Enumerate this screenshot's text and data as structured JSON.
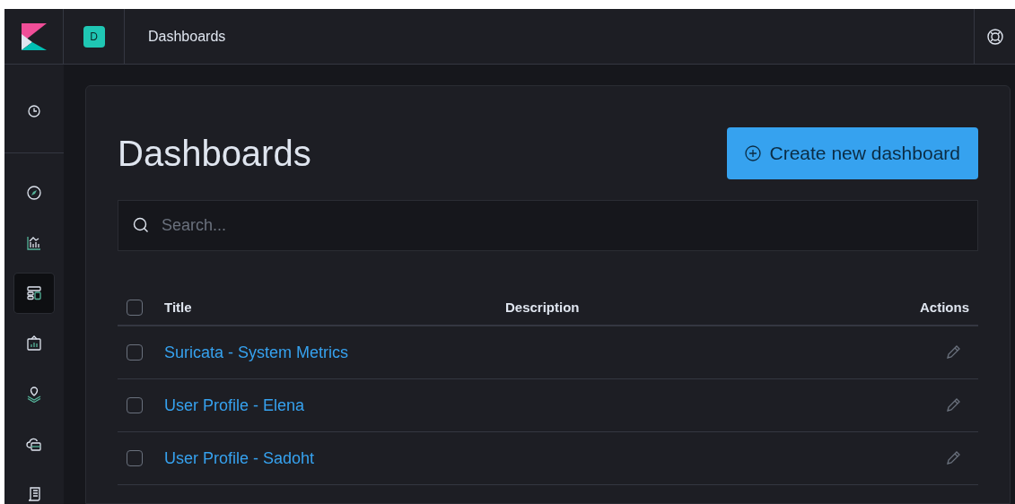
{
  "header": {
    "space_badge": "D",
    "breadcrumb": "Dashboards"
  },
  "sidebar": {
    "items": [
      {
        "kind": "recent",
        "selected": false
      },
      {
        "kind": "discover",
        "selected": false
      },
      {
        "kind": "visualize",
        "selected": false
      },
      {
        "kind": "dashboard",
        "selected": true
      },
      {
        "kind": "canvas",
        "selected": false
      },
      {
        "kind": "maps",
        "selected": false
      },
      {
        "kind": "infrastructure",
        "selected": false
      },
      {
        "kind": "logs",
        "selected": false
      }
    ]
  },
  "page": {
    "title": "Dashboards",
    "create_button": "Create new dashboard",
    "search": {
      "placeholder": "Search..."
    },
    "table": {
      "select_all": {
        "checked": false
      },
      "columns": [
        "Title",
        "Description",
        "Actions"
      ],
      "rows": [
        {
          "title": "Suricata - System Metrics",
          "checked": false
        },
        {
          "title": "User Profile - Elena",
          "checked": false
        },
        {
          "title": "User Profile - Sadoht",
          "checked": false
        }
      ]
    }
  }
}
